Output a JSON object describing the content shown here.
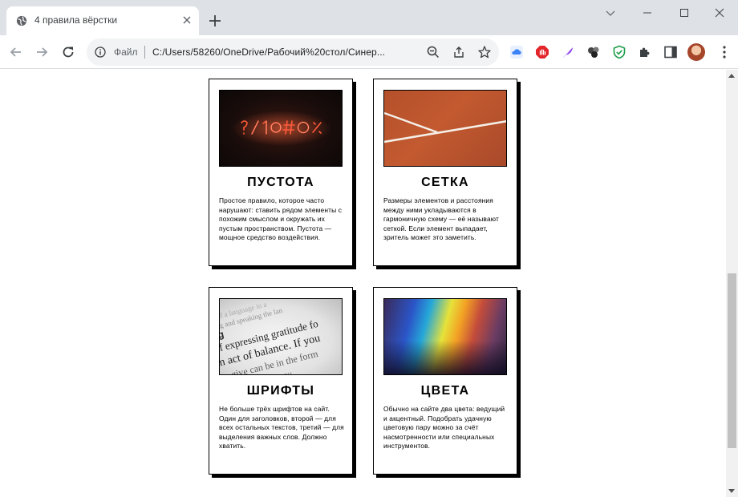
{
  "browser": {
    "tab_title": "4 правила вёрстки",
    "omnibox_label": "Файл",
    "url": "C:/Users/58260/OneDrive/Рабочий%20стол/Синер..."
  },
  "cards": [
    {
      "title": "ПУСТОТА",
      "text": "Простое правило, которое часто нарушают: ставить рядом элементы с похожим смыслом и окружать их пустым пространством. Пустота — мощное средство воздействия.",
      "image": "neon-symbols-image"
    },
    {
      "title": "СЕТКА",
      "text": "Размеры элементов и расстояния между ними укладываются в гармоничную схему — её называют сеткой. Если элемент выпадает, зритель может это заметить.",
      "image": "clay-court-image"
    },
    {
      "title": "ШРИФТЫ",
      "text": "Не больше трёх шрифтов на сайт. Один для заголовков, второй — для всех остальных текстов, третий — для выделения важных слов. Должно хватить.",
      "image": "printed-text-image"
    },
    {
      "title": "ЦВЕТА",
      "text": "Обычно на сайте два цвета: ведущий и акцентный. Подобрать удачную цветовую пару можно за счёт насмотренности или специальных инструментов.",
      "image": "rainbow-blur-image"
    }
  ],
  "print_image_text": "of expressing gratitude fo an act of balance. If you ting",
  "colors": {
    "chrome_bg": "#dee1e6",
    "omnibox_bg": "#f1f3f4",
    "card_border": "#000000"
  }
}
